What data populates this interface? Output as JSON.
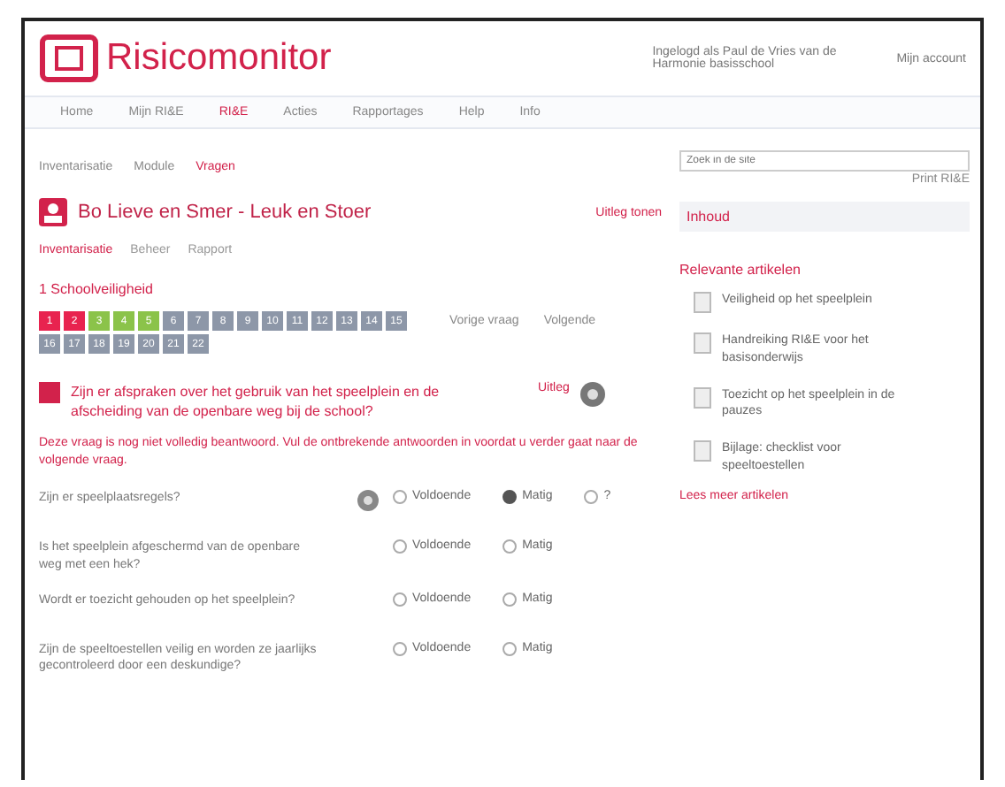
{
  "header": {
    "logo": "Risicomonitor",
    "notice": "Ingelogd als Paul de Vries van de Harmonie basisschool",
    "account": "Mijn account"
  },
  "nav": [
    {
      "label": "Home",
      "selected": false
    },
    {
      "label": "Mijn RI&E",
      "selected": false
    },
    {
      "label": "RI&E",
      "selected": true
    },
    {
      "label": "Acties",
      "selected": false
    },
    {
      "label": "Rapportages",
      "selected": false
    },
    {
      "label": "Help",
      "selected": false
    },
    {
      "label": "Info",
      "selected": false
    }
  ],
  "sidebar_search": {
    "placeholder": "Zoek in de site"
  },
  "sidebar_link": "Print RI&E",
  "breadcrumbs": [
    {
      "label": "Inventarisatie",
      "selected": false
    },
    {
      "label": "Module",
      "selected": false
    },
    {
      "label": "Vragen",
      "selected": true
    }
  ],
  "title": "Bo Lieve en Smer - Leuk en Stoer",
  "title_action": "Uitleg tonen",
  "subtabs": [
    {
      "label": "Inventarisatie",
      "selected": true
    },
    {
      "label": "Beheer",
      "selected": false
    },
    {
      "label": "Rapport",
      "selected": false
    }
  ],
  "section": "1 Schoolveiligheid",
  "steps": [
    {
      "label": "1",
      "kind": "wrong"
    },
    {
      "label": "2",
      "kind": "wrong"
    },
    {
      "label": "3",
      "kind": "done"
    },
    {
      "label": "4",
      "kind": "done"
    },
    {
      "label": "5",
      "kind": "done"
    },
    {
      "label": "6",
      "kind": "open"
    },
    {
      "label": "7",
      "kind": "open"
    },
    {
      "label": "8",
      "kind": "open"
    },
    {
      "label": "9",
      "kind": "open"
    },
    {
      "label": "10",
      "kind": "open"
    },
    {
      "label": "11",
      "kind": "open"
    },
    {
      "label": "12",
      "kind": "open"
    },
    {
      "label": "13",
      "kind": "open"
    },
    {
      "label": "14",
      "kind": "open"
    },
    {
      "label": "15",
      "kind": "open"
    },
    {
      "label": "16",
      "kind": "open"
    },
    {
      "label": "17",
      "kind": "open"
    },
    {
      "label": "18",
      "kind": "open"
    },
    {
      "label": "19",
      "kind": "open"
    },
    {
      "label": "20",
      "kind": "open"
    },
    {
      "label": "21",
      "kind": "open"
    },
    {
      "label": "22",
      "kind": "open"
    }
  ],
  "step_prev": "Vorige vraag",
  "step_next": "Volgende",
  "question": "Zijn er afspraken over het gebruik van het speelplein en de afscheiding van de openbare weg bij de school?",
  "question_link": "Uitleg",
  "warning": "Deze vraag is nog niet volledig beantwoord. Vul de ontbrekende antwoorden in voordat u verder gaat naar de volgende vraag.",
  "answers": [
    {
      "question": "Zijn er speelplaatsregels?",
      "help": true,
      "options": [
        {
          "label": "Voldoende",
          "selected": false
        },
        {
          "label": "Matig",
          "selected": true
        },
        {
          "label": "?",
          "selected": false
        }
      ]
    },
    {
      "question": "Is het speelplein afgeschermd van de openbare weg met een hek?",
      "help": false,
      "options": [
        {
          "label": "Voldoende",
          "selected": false
        },
        {
          "label": "Matig",
          "selected": false
        }
      ]
    },
    {
      "question": "Wordt er toezicht gehouden op het speelplein?",
      "help": false,
      "options": [
        {
          "label": "Voldoende",
          "selected": false
        },
        {
          "label": "Matig",
          "selected": false
        }
      ]
    },
    {
      "question": "Zijn de speeltoestellen veilig en worden ze jaarlijks gecontroleerd door een deskundige?",
      "help": false,
      "options": [
        {
          "label": "Voldoende",
          "selected": false
        },
        {
          "label": "Matig",
          "selected": false
        }
      ]
    }
  ],
  "sidebar": {
    "heading": "Inhoud",
    "articles_title": "Relevante artikelen",
    "articles": [
      "Veiligheid op het speelplein",
      "Handreiking RI&E voor het basisonderwijs",
      "Toezicht op het speelplein in de pauzes",
      "Bijlage: checklist voor speeltoestellen"
    ],
    "more": "Lees meer artikelen"
  }
}
